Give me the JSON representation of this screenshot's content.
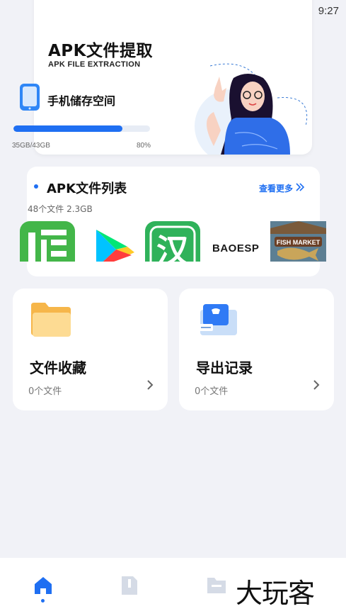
{
  "status_bar": {
    "time": "9:27"
  },
  "hero": {
    "title": "APK文件提取",
    "subtitle": "APK FILE EXTRACTION",
    "storage_label": "手机储存空间",
    "storage_used": "35GB/43GB",
    "storage_percent": "80%",
    "storage_fraction": 0.8
  },
  "apk_list": {
    "title": "APK文件列表",
    "more_label": "查看更多",
    "meta": "48个文件  2.3GB",
    "apps": [
      {
        "name": "app-icon-green",
        "text": ""
      },
      {
        "name": "app-icon-play",
        "text": ""
      },
      {
        "name": "app-icon-han",
        "text": "汉"
      },
      {
        "name": "app-icon-baoesp",
        "text": "BAOESP"
      },
      {
        "name": "app-icon-fish-market",
        "text": "FISH MARKET"
      }
    ]
  },
  "cards": {
    "favorites": {
      "title": "文件收藏",
      "count": "0个文件"
    },
    "export": {
      "title": "导出记录",
      "count": "0个文件"
    }
  },
  "watermark": "大玩客",
  "colors": {
    "accent": "#1f6ff2",
    "background": "#f1f2f7"
  }
}
